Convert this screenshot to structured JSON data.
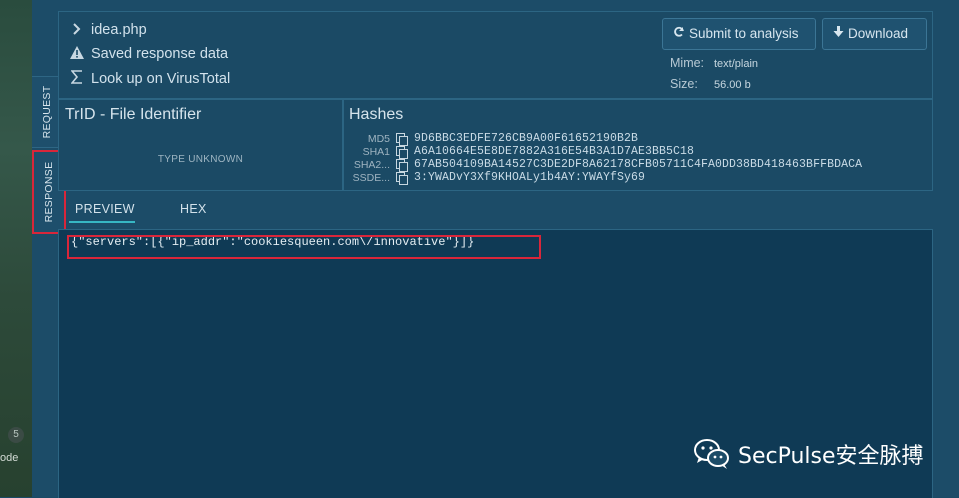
{
  "side_tabs": {
    "request": "REQUEST",
    "response": "RESPONSE"
  },
  "left_strip": {
    "badge": "5",
    "code_text": "ode"
  },
  "file": {
    "name": "idea.php",
    "saved_text": "Saved response data",
    "virustotal_text": "Look up on VirusTotal"
  },
  "buttons": {
    "submit": "Submit to analysis",
    "download": "Download"
  },
  "meta": {
    "mime_label": "Mime:",
    "mime_value": "text/plain",
    "size_label": "Size:",
    "size_value": "56.00 b"
  },
  "trid": {
    "title": "TrID - File Identifier",
    "result": "TYPE UNKNOWN"
  },
  "hashes": {
    "title": "Hashes",
    "rows": [
      {
        "name": "MD5",
        "value": "9D6BBC3EDFE726CB9A00F61652190B2B"
      },
      {
        "name": "SHA1",
        "value": "A6A10664E5E8DE7882A316E54B3A1D7AE3BB5C18"
      },
      {
        "name": "SHA2...",
        "value": "67AB504109BA14527C3DE2DF8A62178CFB05711C4FA0DD38BD418463BFFBDACA"
      },
      {
        "name": "SSDE...",
        "value": "3:YWADvY3Xf9KHOALy1b4AY:YWAYfSy69"
      }
    ]
  },
  "view_tabs": {
    "preview": "PREVIEW",
    "hex": "HEX"
  },
  "preview": {
    "content": "{\"servers\":[{\"ip_addr\":\"cookiesqueen.com\\/innovative\"}]}"
  },
  "watermark": {
    "text": "SecPulse安全脉搏"
  },
  "colors": {
    "accent": "#37b7c4",
    "highlight": "#d9263a",
    "background": "#1c4c68"
  }
}
